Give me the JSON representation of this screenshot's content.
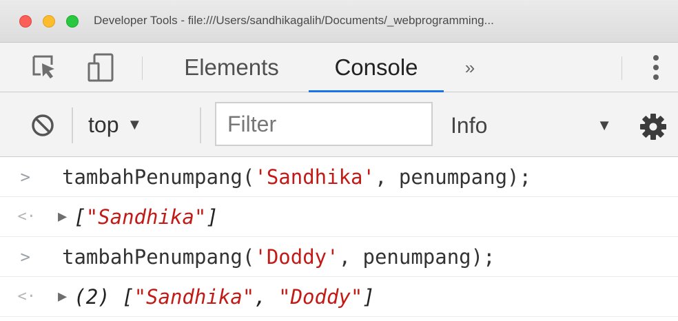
{
  "window": {
    "title": "Developer Tools - file:///Users/sandhikagalih/Documents/_webprogramming..."
  },
  "tabs": {
    "elements": "Elements",
    "console": "Console",
    "more": "»"
  },
  "toolbar": {
    "context": "top",
    "context_arrow": "▼",
    "filter_placeholder": "Filter",
    "level": "Info",
    "level_arrow": "▼"
  },
  "console": {
    "entries": [
      {
        "prompt": ">",
        "fn": "tambahPenumpang(",
        "arg": "'Sandhika'",
        "rest": ", penumpang);"
      },
      {
        "prompt": "<·",
        "expand": "▶",
        "open": "[",
        "items": [
          "\"Sandhika\""
        ],
        "close": "]"
      },
      {
        "prompt": ">",
        "fn": "tambahPenumpang(",
        "arg": "'Doddy'",
        "rest": ", penumpang);"
      },
      {
        "prompt": "<·",
        "expand": "▶",
        "count": "(2)",
        "open": "[",
        "items": [
          "\"Sandhika\"",
          "\"Doddy\""
        ],
        "sep": ", ",
        "close": "]"
      }
    ]
  },
  "icons": {
    "inspect": "inspect-element-icon",
    "device": "device-toolbar-icon",
    "clear": "clear-console-icon",
    "settings": "gear-icon",
    "menu": "kebab-menu-icon"
  }
}
